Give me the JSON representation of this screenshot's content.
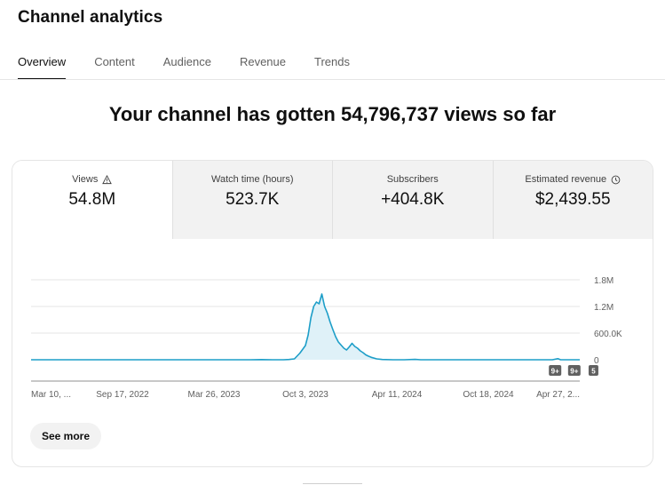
{
  "page_title": "Channel analytics",
  "tabs": [
    {
      "label": "Overview",
      "active": true
    },
    {
      "label": "Content",
      "active": false
    },
    {
      "label": "Audience",
      "active": false
    },
    {
      "label": "Revenue",
      "active": false
    },
    {
      "label": "Trends",
      "active": false
    }
  ],
  "headline": "Your channel has gotten 54,796,737 views so far",
  "metrics": [
    {
      "label": "Views",
      "value": "54.8M",
      "icon": "warning-icon",
      "active": true
    },
    {
      "label": "Watch time (hours)",
      "value": "523.7K",
      "active": false
    },
    {
      "label": "Subscribers",
      "value": "+404.8K",
      "active": false
    },
    {
      "label": "Estimated revenue",
      "value": "$2,439.55",
      "icon": "clock-icon",
      "active": false
    }
  ],
  "see_more_label": "See more",
  "colors": {
    "accent": "#1d9ec8",
    "fill": "#dff1f8",
    "marker": "#606060"
  },
  "chart_data": {
    "type": "area",
    "series": [
      {
        "values": [
          [
            0,
            0
          ],
          [
            0.4,
            0
          ],
          [
            0.42,
            3000
          ],
          [
            0.44,
            0
          ],
          [
            0.46,
            0
          ],
          [
            0.47,
            6000
          ],
          [
            0.48,
            20000
          ],
          [
            0.49,
            150000
          ],
          [
            0.5,
            320000
          ],
          [
            0.505,
            560000
          ],
          [
            0.51,
            950000
          ],
          [
            0.515,
            1200000
          ],
          [
            0.52,
            1300000
          ],
          [
            0.525,
            1260000
          ],
          [
            0.53,
            1480000
          ],
          [
            0.535,
            1200000
          ],
          [
            0.54,
            1050000
          ],
          [
            0.545,
            850000
          ],
          [
            0.55,
            680000
          ],
          [
            0.555,
            520000
          ],
          [
            0.56,
            400000
          ],
          [
            0.565,
            330000
          ],
          [
            0.57,
            260000
          ],
          [
            0.575,
            220000
          ],
          [
            0.58,
            290000
          ],
          [
            0.585,
            370000
          ],
          [
            0.59,
            300000
          ],
          [
            0.595,
            260000
          ],
          [
            0.6,
            200000
          ],
          [
            0.605,
            160000
          ],
          [
            0.61,
            110000
          ],
          [
            0.615,
            80000
          ],
          [
            0.62,
            55000
          ],
          [
            0.63,
            20000
          ],
          [
            0.64,
            6000
          ],
          [
            0.66,
            0
          ],
          [
            0.68,
            0
          ],
          [
            0.7,
            8000
          ],
          [
            0.71,
            0
          ],
          [
            0.95,
            0
          ],
          [
            0.96,
            25000
          ],
          [
            0.965,
            0
          ],
          [
            1.0,
            0
          ]
        ]
      }
    ],
    "x_ticks": [
      "Mar 10, ...",
      "Sep 17, 2022",
      "Mar 26, 2023",
      "Oct 3, 2023",
      "Apr 11, 2024",
      "Oct 18, 2024",
      "Apr 27, 2..."
    ],
    "y_ticks": [
      {
        "label": "1.8M",
        "value": 1800000
      },
      {
        "label": "1.2M",
        "value": 1200000
      },
      {
        "label": "600.0K",
        "value": 600000
      },
      {
        "label": "0",
        "value": 0
      }
    ],
    "ylim": [
      0,
      1800000
    ],
    "grid": true,
    "markers": [
      {
        "label": "9+",
        "x": 0.955
      },
      {
        "label": "9+",
        "x": 0.99
      },
      {
        "label": "5",
        "x": 1.025
      }
    ]
  }
}
